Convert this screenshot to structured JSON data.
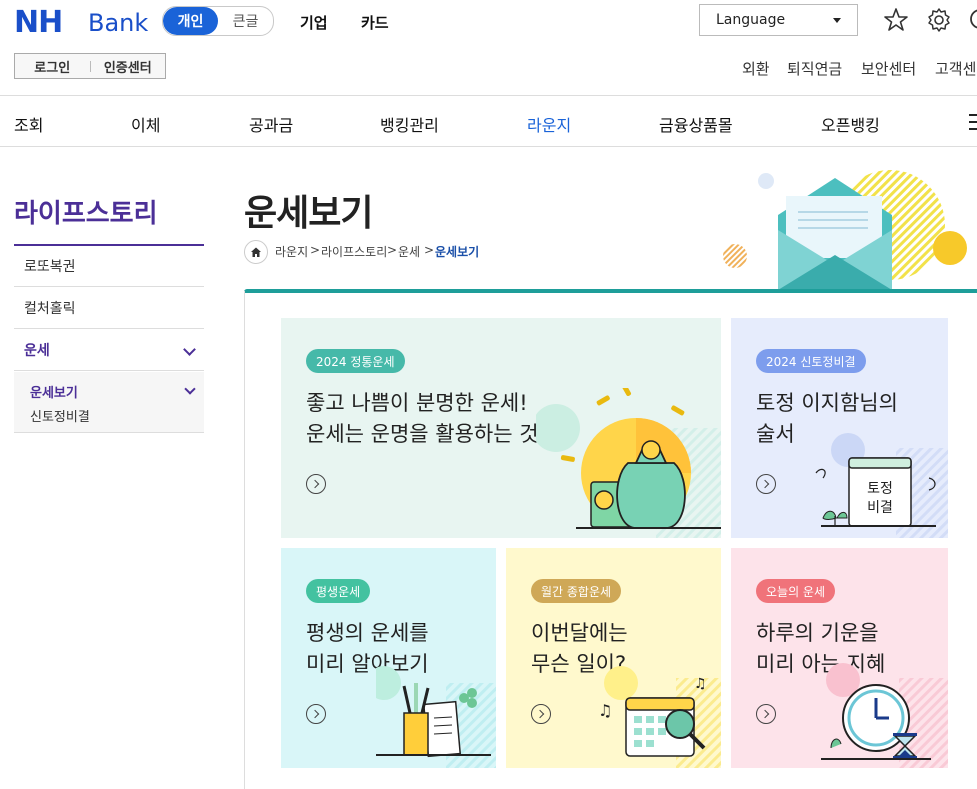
{
  "header": {
    "logo_nh": "NH",
    "logo_bank": "Bank",
    "segment": [
      "개인",
      "큰글"
    ],
    "top_menu": [
      "기업",
      "카드"
    ],
    "language": "Language",
    "login": "로그인",
    "cert": "인증센터",
    "util": [
      "외환",
      "퇴직연금",
      "보안센터",
      "고객센"
    ]
  },
  "gnb": [
    "조회",
    "이체",
    "공과금",
    "뱅킹관리",
    "라운지",
    "금융상품몰",
    "오픈뱅킹"
  ],
  "sidebar": {
    "title": "라이프스토리",
    "items": [
      "로또복권",
      "컬처홀릭",
      "운세"
    ],
    "sub": [
      "운세보기",
      "신토정비결"
    ]
  },
  "page": {
    "title": "운세보기",
    "breadcrumb": [
      "라운지",
      "라이프스토리",
      "운세",
      "운세보기"
    ]
  },
  "cards": [
    {
      "badge": "2024 정통운세",
      "line1": "좋고 나쁨이 분명한 운세!",
      "line2": "운세는 운명을 활용하는 것"
    },
    {
      "badge": "2024 신토정비결",
      "line1": "토정 이지함님의",
      "line2": "술서",
      "book_text": [
        "토정",
        "비결"
      ]
    },
    {
      "badge": "평생운세",
      "line1": "평생의 운세를",
      "line2": "미리 알아보기"
    },
    {
      "badge": "월간 종합운세",
      "line1": "이번달에는",
      "line2": "무슨 일이?"
    },
    {
      "badge": "오늘의 운세",
      "line1": "하루의 기운을",
      "line2": "미리 아는 지혜"
    }
  ],
  "colors": {
    "brand": "#1a4fc9",
    "accent": "#1a63d8",
    "sidebar": "#4b2f97",
    "teal": "#1e9e9a"
  }
}
